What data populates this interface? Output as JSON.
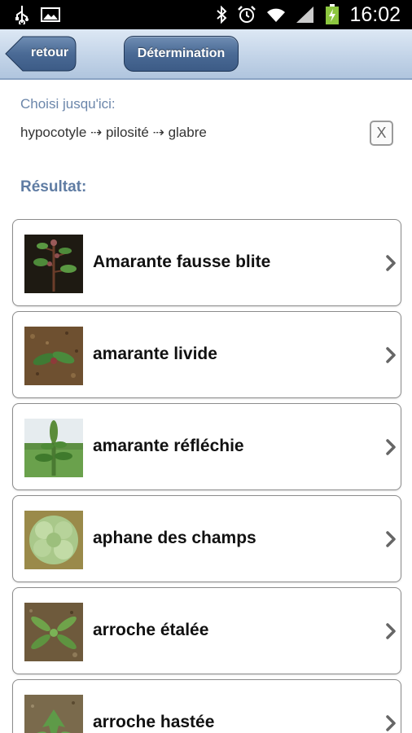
{
  "status_bar": {
    "time": "16:02",
    "left_icons": [
      "usb-icon",
      "image-icon"
    ],
    "right_icons": [
      "bluetooth-icon",
      "alarm-icon",
      "wifi-icon",
      "signal-icon",
      "battery-charging-icon"
    ]
  },
  "header": {
    "back_label": "retour",
    "determination_label": "Détermination",
    "accent_color": "#4a6a95"
  },
  "selection": {
    "label": "Choisi jusqu'ici:",
    "path": "hypocotyle ⇢ pilosité ⇢ glabre",
    "clear_label": "X"
  },
  "results": {
    "label": "Résultat:",
    "items": [
      {
        "label": "Amarante fausse blite",
        "icon": "amarante-fausse-blite-photo"
      },
      {
        "label": "amarante livide",
        "icon": "amarante-livide-photo"
      },
      {
        "label": "amarante réfléchie",
        "icon": "amarante-reflechie-photo"
      },
      {
        "label": "aphane des champs",
        "icon": "aphane-des-champs-photo"
      },
      {
        "label": "arroche étalée",
        "icon": "arroche-etalee-photo"
      },
      {
        "label": "arroche hastée",
        "icon": "arroche-hastee-photo"
      }
    ]
  }
}
